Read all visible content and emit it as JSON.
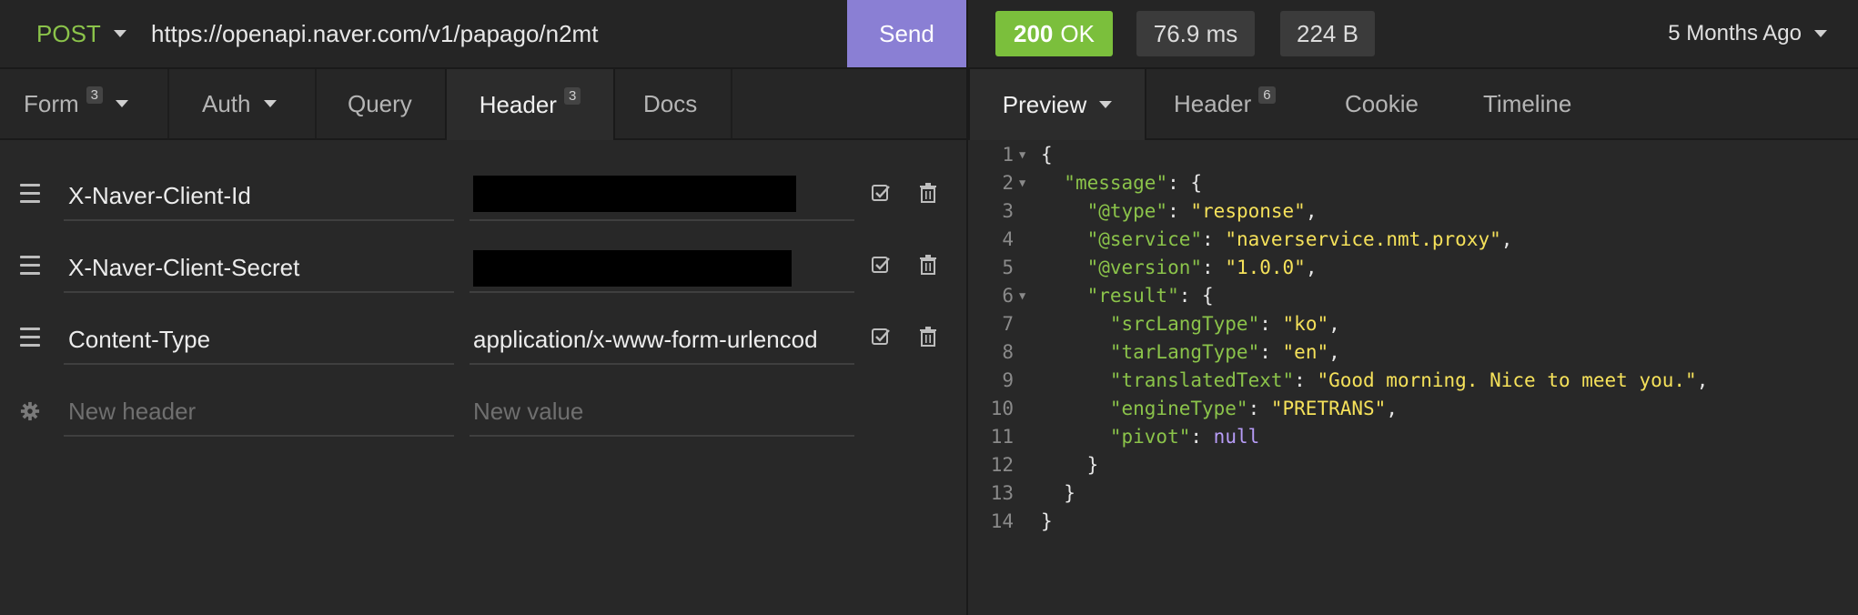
{
  "request": {
    "method": "POST",
    "url": "https://openapi.naver.com/v1/papago/n2mt",
    "send_label": "Send"
  },
  "response_meta": {
    "status_code": "200",
    "status_text": "OK",
    "time": "76.9 ms",
    "size": "224 B",
    "history": "5 Months Ago"
  },
  "request_tabs": {
    "form": {
      "label": "Form",
      "count": "3"
    },
    "auth": {
      "label": "Auth"
    },
    "query": {
      "label": "Query"
    },
    "header": {
      "label": "Header",
      "count": "3"
    },
    "docs": {
      "label": "Docs"
    }
  },
  "response_tabs": {
    "preview": {
      "label": "Preview"
    },
    "header": {
      "label": "Header",
      "count": "6"
    },
    "cookie": {
      "label": "Cookie"
    },
    "timeline": {
      "label": "Timeline"
    }
  },
  "headers": [
    {
      "name": "X-Naver-Client-Id",
      "value": ""
    },
    {
      "name": "X-Naver-Client-Secret",
      "value": ""
    },
    {
      "name": "Content-Type",
      "value": "application/x-www-form-urlencod"
    }
  ],
  "new_header": {
    "name_placeholder": "New header",
    "value_placeholder": "New value"
  },
  "response_body": {
    "ln": [
      "1",
      "2",
      "3",
      "4",
      "5",
      "6",
      "7",
      "8",
      "9",
      "10",
      "11",
      "12",
      "13",
      "14"
    ],
    "open_brace": "{",
    "close_brace": "}",
    "keys": {
      "message": "\"message\"",
      "type": "\"@type\"",
      "service": "\"@service\"",
      "version": "\"@version\"",
      "result": "\"result\"",
      "srcLangType": "\"srcLangType\"",
      "tarLangType": "\"tarLangType\"",
      "translatedText": "\"translatedText\"",
      "engineType": "\"engineType\"",
      "pivot": "\"pivot\""
    },
    "values": {
      "type": "\"response\"",
      "service": "\"naverservice.nmt.proxy\"",
      "version": "\"1.0.0\"",
      "srcLangType": "\"ko\"",
      "tarLangType": "\"en\"",
      "translatedText": "\"Good morning. Nice to meet you.\"",
      "engineType": "\"PRETRANS\"",
      "pivot": "null"
    }
  },
  "colors": {
    "method": "#8bc34a",
    "send": "#8a7fd4",
    "status_ok": "#7bbf3c",
    "json_key": "#8bc34a",
    "json_string": "#f5e15a",
    "json_null": "#b79cf7"
  }
}
